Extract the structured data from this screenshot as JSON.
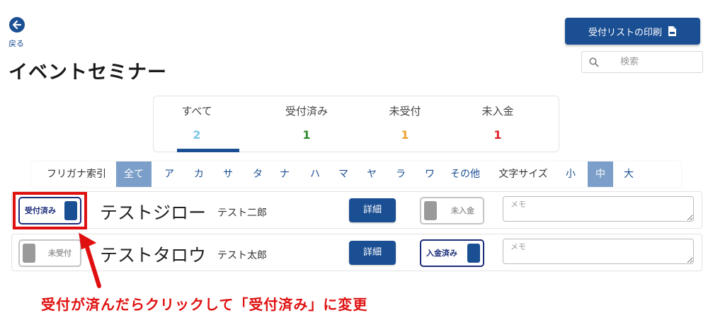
{
  "back": {
    "label": "戻る"
  },
  "page_title": "イベントセミナー",
  "print_button": "受付リストの印刷",
  "search": {
    "placeholder": "検索"
  },
  "stats": [
    {
      "label": "すべて",
      "value": "2",
      "color": "#7ec6e8"
    },
    {
      "label": "受付済み",
      "value": "1",
      "color": "#2e8b2e"
    },
    {
      "label": "未受付",
      "value": "1",
      "color": "#f0a030"
    },
    {
      "label": "未入金",
      "value": "1",
      "color": "#e0202a"
    }
  ],
  "index": {
    "label": "フリガナ索引",
    "items": [
      "全て",
      "ア",
      "カ",
      "サ",
      "タ",
      "ナ",
      "ハ",
      "マ",
      "ヤ",
      "ラ",
      "ワ",
      "その他"
    ],
    "font_label": "文字サイズ",
    "sizes": [
      "小",
      "中",
      "大"
    ]
  },
  "rows": [
    {
      "reception": "受付済み",
      "name": "テストジロー",
      "kana": "テスト二郎",
      "detail": "詳細",
      "payment": "未入金",
      "memo_placeholder": "メモ"
    },
    {
      "reception": "未受付",
      "name": "テストタロウ",
      "kana": "テスト太郎",
      "detail": "詳細",
      "payment": "入金済み",
      "memo_placeholder": "メモ"
    }
  ],
  "annotation": "受付が済んだらクリックして「受付済み」に変更",
  "colors": {
    "primary": "#1b4f93",
    "annotation": "#e01010"
  }
}
